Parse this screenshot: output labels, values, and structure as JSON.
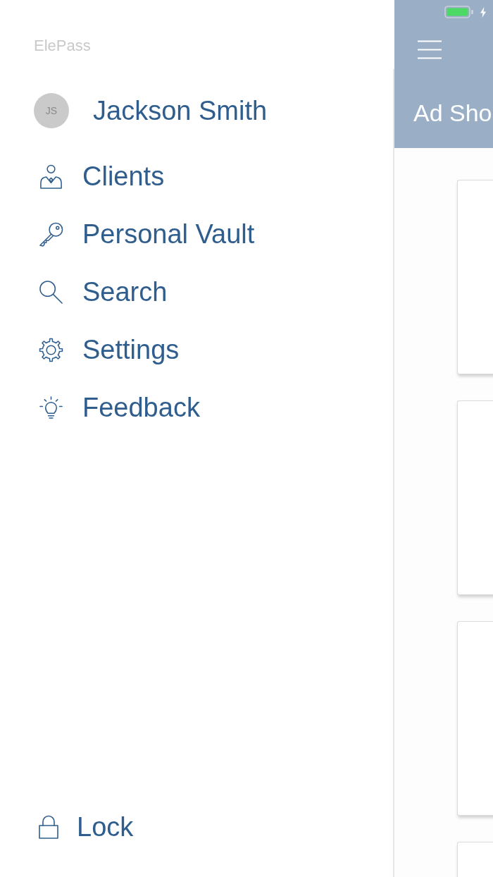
{
  "app_name": "ElePass",
  "user": {
    "initials": "JS",
    "name": "Jackson Smith"
  },
  "menu": [
    {
      "kind": "clients",
      "label": "Clients"
    },
    {
      "kind": "vault",
      "label": "Personal Vault"
    },
    {
      "kind": "search",
      "label": "Search"
    },
    {
      "kind": "settings",
      "label": "Settings"
    },
    {
      "kind": "feedback",
      "label": "Feedback"
    }
  ],
  "lock": {
    "label": "Lock"
  },
  "status_bar": {
    "charging": true
  },
  "main": {
    "title": "Ad Sho"
  }
}
